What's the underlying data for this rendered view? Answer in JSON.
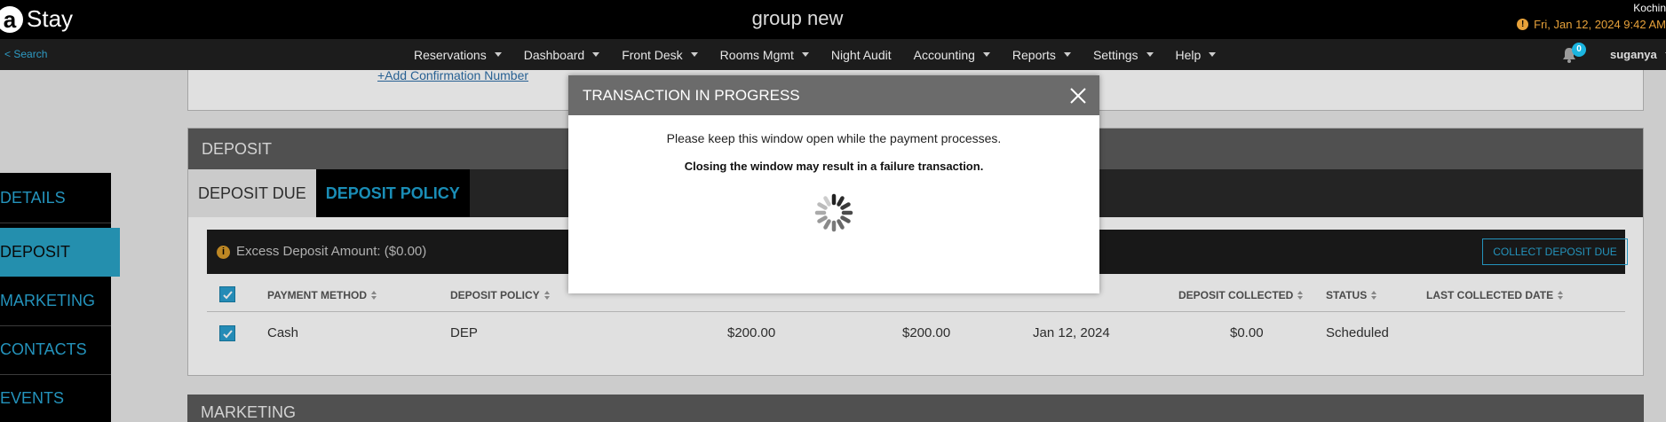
{
  "header": {
    "logo_mark": "a",
    "logo_text": "Stay",
    "title": "group new",
    "city": "Kochin",
    "datetime": "Fri, Jan 12, 2024 9:42 AM",
    "warn_glyph": "!"
  },
  "nav": {
    "search_label": "< Search",
    "items": [
      {
        "label": "Reservations",
        "has_caret": true
      },
      {
        "label": "Dashboard",
        "has_caret": true
      },
      {
        "label": "Front Desk",
        "has_caret": true
      },
      {
        "label": "Rooms Mgmt",
        "has_caret": true
      },
      {
        "label": "Night Audit",
        "has_caret": false
      },
      {
        "label": "Accounting",
        "has_caret": true
      },
      {
        "label": "Reports",
        "has_caret": true
      },
      {
        "label": "Settings",
        "has_caret": true
      },
      {
        "label": "Help",
        "has_caret": true
      }
    ],
    "notification_count": "0",
    "user": "suganya"
  },
  "side_menu": {
    "items": [
      {
        "label": "DETAILS",
        "active": false
      },
      {
        "label": "DEPOSIT",
        "active": true
      },
      {
        "label": "MARKETING",
        "active": false
      },
      {
        "label": "CONTACTS",
        "active": false
      },
      {
        "label": "EVENTS",
        "active": false
      }
    ]
  },
  "confirmation": {
    "add_link": "+Add Confirmation Number"
  },
  "deposit": {
    "section_title": "DEPOSIT",
    "tabs": {
      "due": "DEPOSIT DUE",
      "policy": "DEPOSIT POLICY"
    },
    "excess_glyph": "i",
    "excess_text": "Excess Deposit Amount: ($0.00)",
    "collect_button": "COLLECT DEPOSIT DUE",
    "columns": {
      "payment_method": "PAYMENT METHOD",
      "deposit_policy": "DEPOSIT POLICY",
      "deposit_collected": "DEPOSIT COLLECTED",
      "status": "STATUS",
      "last_collected_date": "LAST COLLECTED DATE"
    },
    "row": {
      "payment_method": "Cash",
      "deposit_policy": "DEP",
      "amount1": "$200.00",
      "amount2": "$200.00",
      "date": "Jan 12, 2024",
      "deposit_collected": "$0.00",
      "status": "Scheduled"
    }
  },
  "marketing": {
    "section_title": "MARKETING"
  },
  "modal": {
    "title": "TRANSACTION IN PROGRESS",
    "message": "Please keep this window open while the payment processes.",
    "warning": "Closing the window may result in a failure transaction."
  },
  "colors": {
    "accent": "#2aa8d6",
    "warning": "#e8a23a"
  }
}
